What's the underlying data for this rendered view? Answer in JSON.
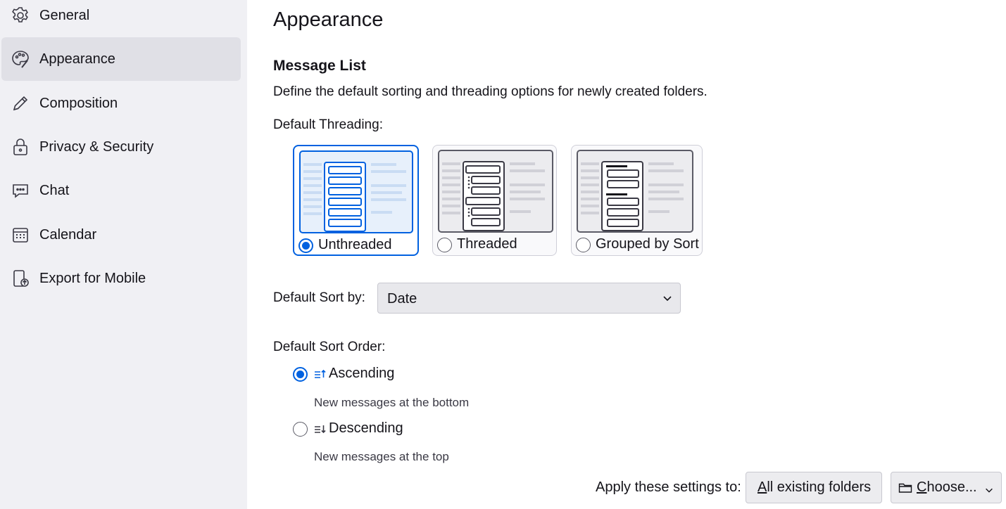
{
  "sidebar": {
    "items": [
      {
        "label": "General",
        "icon": "gear-icon",
        "selected": false
      },
      {
        "label": "Appearance",
        "icon": "palette-icon",
        "selected": true
      },
      {
        "label": "Composition",
        "icon": "pencil-icon",
        "selected": false
      },
      {
        "label": "Privacy & Security",
        "icon": "lock-icon",
        "selected": false
      },
      {
        "label": "Chat",
        "icon": "chat-bubble-icon",
        "selected": false
      },
      {
        "label": "Calendar",
        "icon": "calendar-icon",
        "selected": false
      },
      {
        "label": "Export for Mobile",
        "icon": "mobile-export-icon",
        "selected": false
      }
    ]
  },
  "main": {
    "title": "Appearance",
    "section_title": "Message List",
    "section_desc": "Define the default sorting and threading options for newly created folders.",
    "threading_label": "Default Threading:",
    "threading_options": [
      {
        "label": "Unthreaded",
        "checked": true
      },
      {
        "label": "Threaded",
        "checked": false
      },
      {
        "label": "Grouped by Sort",
        "checked": false
      }
    ],
    "sort_by_label": "Default Sort by:",
    "sort_by_value": "Date",
    "sort_order_label": "Default Sort Order:",
    "sort_order_options": [
      {
        "label": "Ascending",
        "desc": "New messages at the bottom",
        "icon": "sort-ascending-icon",
        "checked": true
      },
      {
        "label": "Descending",
        "desc": "New messages at the top",
        "icon": "sort-descending-icon",
        "checked": false
      }
    ],
    "apply_label": "Apply these settings to:",
    "apply_all_prefix": "A",
    "apply_all_rest": "ll existing folders",
    "choose_prefix": "C",
    "choose_rest": "hoose..."
  },
  "colors": {
    "accent": "#0061e0",
    "sidebar_bg": "#f0f0f4",
    "sidebar_selected": "#e0e0e6"
  }
}
